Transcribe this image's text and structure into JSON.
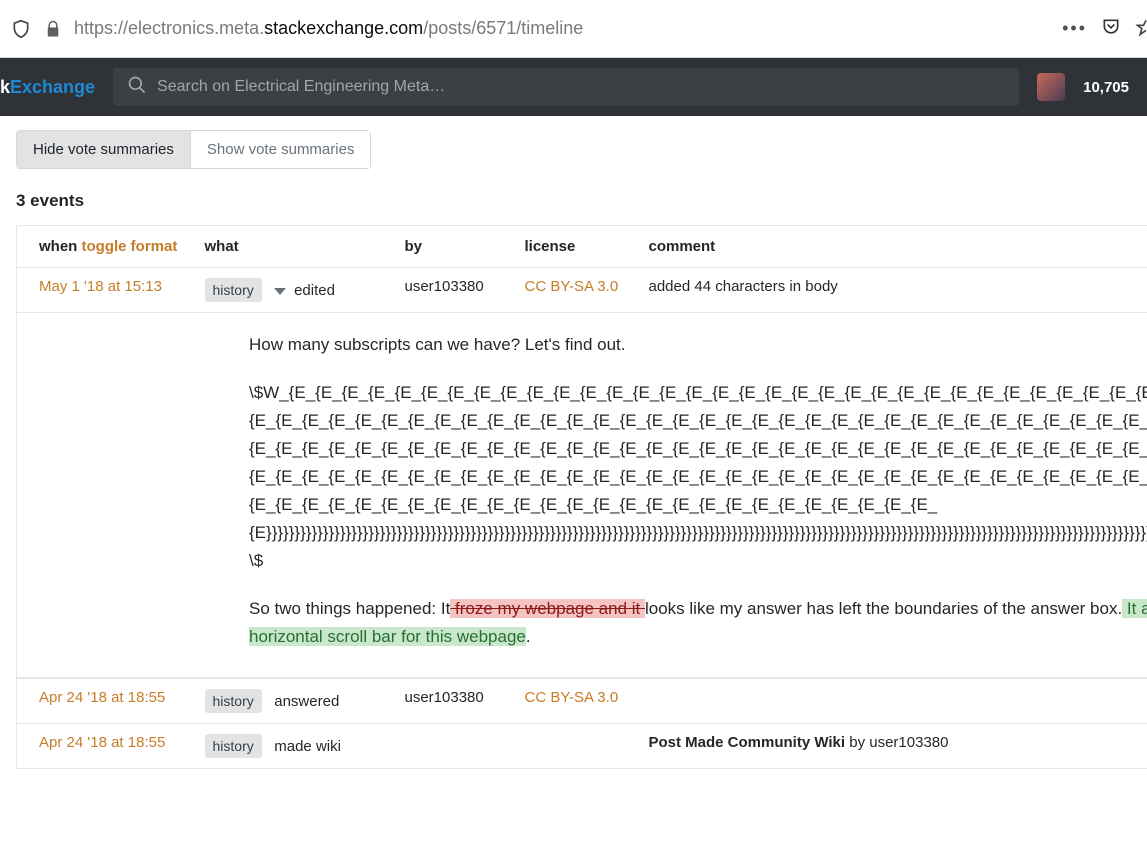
{
  "browser": {
    "url_pre": "https://electronics.meta.",
    "url_domain": "stackexchange.com",
    "url_post": "/posts/6571/timeline",
    "dots": "•••"
  },
  "header": {
    "logo_k": "k",
    "logo_exchange": "Exchange",
    "search_placeholder": "Search on Electrical Engineering Meta…",
    "rep": "10,705"
  },
  "toggle": {
    "hide": "Hide vote summaries",
    "show": "Show vote summaries"
  },
  "events_title": "3 events",
  "columns": {
    "when": "when",
    "toggle_format": "toggle format",
    "what": "what",
    "by": "by",
    "license": "license",
    "comment": "comment"
  },
  "rows": [
    {
      "when": "May 1 '18 at 15:13",
      "badge": "history",
      "action": "edited",
      "by": "user103380",
      "license": "CC BY-SA 3.0",
      "comment": "added 44 characters in body"
    },
    {
      "when": "Apr 24 '18 at 18:55",
      "badge": "history",
      "action": "answered",
      "by": "user103380",
      "license": "CC BY-SA 3.0",
      "comment": ""
    },
    {
      "when": "Apr 24 '18 at 18:55",
      "badge": "history",
      "action": "made wiki",
      "by": "",
      "license": "",
      "comment_rich": {
        "bold": "Post Made Community Wiki",
        "rest": " by user103380"
      }
    }
  ],
  "body": {
    "p1": "How many subscripts can we have? Let's find out.",
    "p2": "\\$W_{E_{E_{E_{E_{E_{E_{E_{E_{E_{E_{E_{E_{E_{E_{E_{E_{E_{E_{E_{E_{E_{E_{E_{E_{E_{E_{E_{E_{E_{E_{E_{E_{E_{E_{E_{E_{E_{E_{E_{E_{E_{E_{E_{E_{E_{E_{E_{E_{E_{E_{E_{E_{E_{E_{E_{E_{E_{E_{E_{E_{E_{E_{E_{E_{E_{E_{E_{E_{E_{E_{E_{E_{E_{E_{E_{E_{E_{E_{E_{E_{E_{E_{E_{E_{E_{E_{E_{E_{E_{E_{E_{E_{E_{E_{E_{E_{E_{E_{E_{E_{E_{E_{E_{E_{E_{E_{E_{E_{E_{E_{E_{E_{E_{E_{E_{E_{E_{E_{E_{E_{E_{E_{E_{E_{E_{E_{E_{E_{E_{E_{E_{E_{E_{E_{E_{E_{E_{E_{E_{E_{E_{E_{E_{E_{E_{E_{E_{E_{E_{E_{E_{E_{E_{E_{E_{E_{E_{E_{E_{E_{E_{E_{E_{E_{E_{E_{E_{E_{E_{E_{E_{E_{E_{E_{E_{E_{E_{E_{E_{E_{E_{E_{E_{E_{E_{E_{E_{E_{E_{E_{E_{E_{E_{E_{E_{E_{E}}}}}}}}}}}}}}}}}}}}}}}}}}}}}}}}}}}}}}}}}}}}}}}}}}}}}}}}}}}}}}}}}}}}}}}}}}}}}}}}}}}}}}}}}}}}}}}}}}}}}}}}}}}}}}}}}}}}}}}}}}}}}}}}}}}}}}}}}}}}}}}}}}}}}}}}}}}}}}}}}}}}}}}}}}}}}}}}}}}}}}}}}}}}}}}}}}}}}}\\$",
    "p3_pre": "So two things happened: It",
    "p3_del": " froze my webpage and it ",
    "p3_mid": "looks like my answer has left the boundaries of the answer box.",
    "p3_add": " It also looks like I make a horizontal scroll bar for this webpage",
    "p3_post": "."
  }
}
